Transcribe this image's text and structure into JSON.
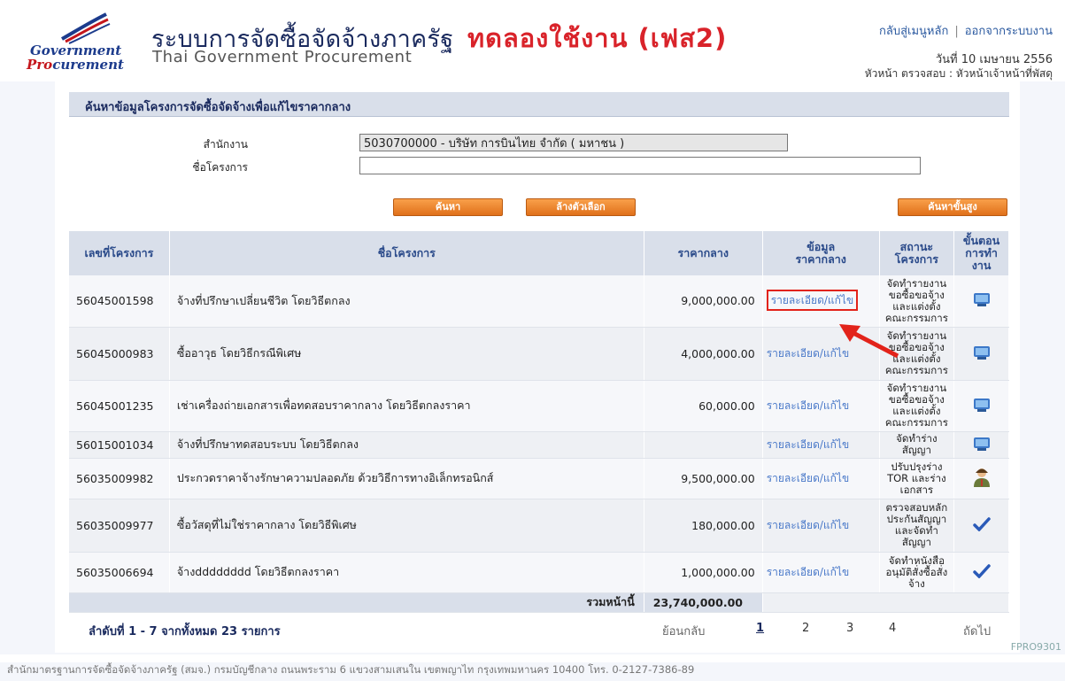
{
  "header": {
    "logo_top": "Government",
    "logo_bottom_red": "Pro",
    "logo_bottom_blue": "curement",
    "title_th": "ระบบการจัดซื้อจัดจ้างภาครัฐ",
    "title_test": "ทดลองใช้งาน (เฟส2)",
    "title_en": "Thai Government Procurement",
    "link_home": "กลับสู่เมนูหลัก",
    "link_sep": "|",
    "link_logout": "ออกจากระบบงาน",
    "date": "วันที่ 10 เมษายน 2556",
    "role": "หัวหน้า ตรวจสอบ : หัวหน้าเจ้าหน้าที่พัสดุ"
  },
  "search": {
    "section_title": "ค้นหาข้อมูลโครงการจัดซื้อจัดจ้างเพื่อแก้ไขราคากลาง",
    "office_label": "สำนักงาน",
    "office_value": "5030700000 - บริษัท การบินไทย จำกัด ( มหาชน )",
    "project_label": "ชื่อโครงการ",
    "project_value": "",
    "btn_search": "ค้นหา",
    "btn_clear": "ล้างตัวเลือก",
    "btn_advanced": "ค้นหาขั้นสูง"
  },
  "table": {
    "headers": {
      "no": "เลขที่โครงการ",
      "name": "ชื่อโครงการ",
      "price": "ราคากลาง",
      "info_1": "ข้อมูล",
      "info_2": "ราคากลาง",
      "status_1": "สถานะ",
      "status_2": "โครงการ",
      "step_1": "ขั้นตอน",
      "step_2": "การทำ",
      "step_3": "งาน"
    },
    "link_text": "รายละเอียด/แก้ไข",
    "rows": [
      {
        "no": "56045001598",
        "name": "จ้างที่ปรึกษาเปลี่ยนชีวิต โดยวิธีตกลง",
        "price": "9,000,000.00",
        "status_1": "จัดทำรายงาน",
        "status_2": "ขอซื้อขอจ้าง",
        "status_3": "และแต่งตั้ง",
        "status_4": "คณะกรรมการ",
        "step_icon": "computer-icon"
      },
      {
        "no": "56045000983",
        "name": "ซื้ออาวุธ โดยวิธีกรณีพิเศษ",
        "price": "4,000,000.00",
        "status_1": "จัดทำรายงาน",
        "status_2": "ขอซื้อขอจ้าง",
        "status_3": "และแต่งตั้ง",
        "status_4": "คณะกรรมการ",
        "step_icon": "computer-icon"
      },
      {
        "no": "56045001235",
        "name": "เช่าเครื่องถ่ายเอกสารเพื่อทดสอบราคากลาง โดยวิธีตกลงราคา",
        "price": "60,000.00",
        "status_1": "จัดทำรายงาน",
        "status_2": "ขอซื้อขอจ้าง",
        "status_3": "และแต่งตั้ง",
        "status_4": "คณะกรรมการ",
        "step_icon": "computer-icon"
      },
      {
        "no": "56015001034",
        "name": "จ้างที่ปรึกษาทดสอบระบบ โดยวิธีตกลง",
        "price": "",
        "status_1": "จัดทำร่าง",
        "status_2": "สัญญา",
        "status_3": "",
        "status_4": "",
        "step_icon": "computer-icon"
      },
      {
        "no": "56035009982",
        "name": "ประกวดราคาจ้างรักษาความปลอดภัย ด้วยวิธีการทางอิเล็กทรอนิกส์",
        "price": "9,500,000.00",
        "status_1": "ปรับปรุงร่าง",
        "status_2": "TOR และร่าง",
        "status_3": "เอกสาร",
        "status_4": "",
        "step_icon": "person-icon"
      },
      {
        "no": "56035009977",
        "name": "ซื้อวัสดุที่ไม่ใช่ราคากลาง โดยวิธีพิเศษ",
        "price": "180,000.00",
        "status_1": "ตรวจสอบหลัก",
        "status_2": "ประกันสัญญา",
        "status_3": "และจัดทำ",
        "status_4": "สัญญา",
        "step_icon": "checkmark-icon"
      },
      {
        "no": "56035006694",
        "name": "จ้างdddddddd โดยวิธีตกลงราคา",
        "price": "1,000,000.00",
        "status_1": "จัดทำหนังสือ",
        "status_2": "อนุมัติสั่งซื้อสั่ง",
        "status_3": "จ้าง",
        "status_4": "",
        "step_icon": "checkmark-icon"
      }
    ],
    "sum_label": "รวมหน้านี้",
    "sum_value": "23,740,000.00"
  },
  "pager": {
    "info_prefix": "ลำดับที่",
    "info_range": "1 - 7",
    "info_mid": "จากทั้งหมด",
    "info_total": "23",
    "info_suffix": "รายการ",
    "back": "ย้อนกลับ",
    "pages": [
      "1",
      "2",
      "3",
      "4"
    ],
    "next": "ถัดไป"
  },
  "footer": {
    "text": "สำนักมาตรฐานการจัดซื้อจัดจ้างภาครัฐ (สมจ.) กรมบัญชีกลาง ถนนพระราม 6 แขวงสามเสนใน เขตพญาไท กรุงเทพมหานคร 10400 โทร. 0-2127-7386-89",
    "code": "FPRO9301"
  },
  "colors": {
    "accent_orange": "#e0701a",
    "title_red": "#d9232a",
    "link_blue": "#4a79c9",
    "header_bg": "#d9dfea",
    "highlight_red": "#e2231a"
  }
}
